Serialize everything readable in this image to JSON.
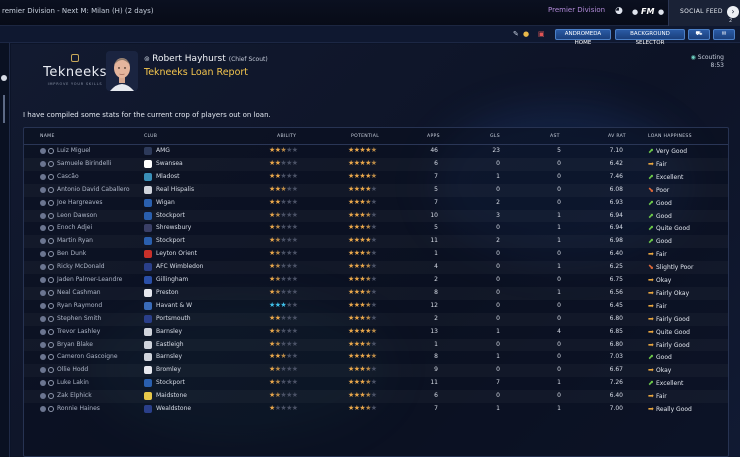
{
  "topbar": {
    "title": "remier Division - Next M: Milan (H) (2 days)",
    "brand": "Premier Division",
    "fm_label": "FM",
    "social_label": "SOCIAL FEED",
    "social_count": "2"
  },
  "subbar": {
    "andromeda_label": "ANDROMEDA HOME",
    "background_label": "BACKGROUND SELECTOR"
  },
  "logo": {
    "word": "Tekneeks",
    "tagline": "IMPROVE YOUR SKILLS"
  },
  "staff": {
    "name": "Robert Hayhurst",
    "role": "(Chief Scout)",
    "report_title": "Tekneeks Loan Report"
  },
  "scouting": {
    "label": "Scouting",
    "time": "8:53"
  },
  "intro": "I have compiled some stats for the current crop of players out on loan.",
  "columns": {
    "name": "NAME",
    "club": "CLUB",
    "ability": "ABILITY",
    "potential": "POTENTIAL",
    "apps": "APPS",
    "gls": "GLS",
    "ast": "AST",
    "avrat": "AV RAT",
    "happiness": "LOAN HAPPINESS"
  },
  "colors": {
    "accent": "#f3c54e",
    "star_on": "#e8a64a",
    "star_off": "#4b5266",
    "star_cyan": "#3fbfe8",
    "up": "#6cc84a",
    "side": "#e8a640",
    "down": "#e06a3a"
  },
  "players": [
    {
      "name": "Luiz Miguel",
      "club": "AMG",
      "crest": "#2d3a5a",
      "ability": 2.5,
      "potential": 4.5,
      "apps": "46",
      "gls": "23",
      "ast": "5",
      "avrat": "7.10",
      "happiness": "Very Good",
      "dir": "up"
    },
    {
      "name": "Samuele Birindelli",
      "club": "Swansea",
      "crest": "#ffffff",
      "ability": 2,
      "potential": 4.5,
      "apps": "6",
      "gls": "0",
      "ast": "0",
      "avrat": "6.42",
      "happiness": "Fair",
      "dir": "side"
    },
    {
      "name": "Cascão",
      "club": "Mladost",
      "crest": "#3a8fb8",
      "ability": 2,
      "potential": 4.5,
      "apps": "7",
      "gls": "1",
      "ast": "0",
      "avrat": "7.46",
      "happiness": "Excellent",
      "dir": "up"
    },
    {
      "name": "Antonio David Caballero",
      "club": "Real Hispalis",
      "crest": "#d0d4dc",
      "ability": 2.5,
      "potential": 4,
      "apps": "5",
      "gls": "0",
      "ast": "0",
      "avrat": "6.08",
      "happiness": "Poor",
      "dir": "down"
    },
    {
      "name": "Joe Hargreaves",
      "club": "Wigan",
      "crest": "#2a5fae",
      "ability": 2,
      "potential": 3.5,
      "apps": "7",
      "gls": "2",
      "ast": "0",
      "avrat": "6.93",
      "happiness": "Good",
      "dir": "up"
    },
    {
      "name": "Leon Dawson",
      "club": "Stockport",
      "crest": "#2a5fae",
      "ability": 1.5,
      "potential": 3.5,
      "apps": "10",
      "gls": "3",
      "ast": "1",
      "avrat": "6.94",
      "happiness": "Good",
      "dir": "up"
    },
    {
      "name": "Enoch Adjei",
      "club": "Shrewsbury",
      "crest": "#3a3f66",
      "ability": 1.5,
      "potential": 3.5,
      "apps": "5",
      "gls": "0",
      "ast": "1",
      "avrat": "6.94",
      "happiness": "Quite Good",
      "dir": "up"
    },
    {
      "name": "Martin Ryan",
      "club": "Stockport",
      "crest": "#2a5fae",
      "ability": 1.5,
      "potential": 4,
      "apps": "11",
      "gls": "2",
      "ast": "1",
      "avrat": "6.98",
      "happiness": "Good",
      "dir": "up"
    },
    {
      "name": "Ben Dunk",
      "club": "Leyton Orient",
      "crest": "#c8302a",
      "ability": 1.5,
      "potential": 3.5,
      "apps": "1",
      "gls": "0",
      "ast": "0",
      "avrat": "6.40",
      "happiness": "Fair",
      "dir": "side"
    },
    {
      "name": "Ricky McDonald",
      "club": "AFC Wimbledon",
      "crest": "#2a3f8a",
      "ability": 1.5,
      "potential": 3.5,
      "apps": "4",
      "gls": "0",
      "ast": "1",
      "avrat": "6.25",
      "happiness": "Slightly Poor",
      "dir": "down"
    },
    {
      "name": "Jaden Palmer-Leandre",
      "club": "Gillingham",
      "crest": "#2a4fa8",
      "ability": 1.5,
      "potential": 3.5,
      "apps": "2",
      "gls": "0",
      "ast": "0",
      "avrat": "6.75",
      "happiness": "Okay",
      "dir": "side"
    },
    {
      "name": "Neal Cashman",
      "club": "Preston",
      "crest": "#e6e8ee",
      "ability": 1.5,
      "potential": 3.5,
      "apps": "8",
      "gls": "0",
      "ast": "1",
      "avrat": "6.56",
      "happiness": "Fairly Okay",
      "dir": "side"
    },
    {
      "name": "Ryan Raymond",
      "club": "Havant & W",
      "crest": "#3a6bb8",
      "ability": 3,
      "potential": 3.5,
      "apps": "12",
      "gls": "0",
      "ast": "0",
      "avrat": "6.45",
      "happiness": "Fair",
      "dir": "side",
      "cyan": true
    },
    {
      "name": "Stephen Smith",
      "club": "Portsmouth",
      "crest": "#2a3f8a",
      "ability": 2,
      "potential": 3.5,
      "apps": "2",
      "gls": "0",
      "ast": "0",
      "avrat": "6.80",
      "happiness": "Fairly Good",
      "dir": "side"
    },
    {
      "name": "Trevor Lashley",
      "club": "Barnsley",
      "crest": "#d0d4dc",
      "ability": 1.5,
      "potential": 4.5,
      "apps": "13",
      "gls": "1",
      "ast": "4",
      "avrat": "6.85",
      "happiness": "Quite Good",
      "dir": "side"
    },
    {
      "name": "Bryan Blake",
      "club": "Eastleigh",
      "crest": "#d0d4dc",
      "ability": 1.5,
      "potential": 3.5,
      "apps": "1",
      "gls": "0",
      "ast": "0",
      "avrat": "6.80",
      "happiness": "Fairly Good",
      "dir": "side"
    },
    {
      "name": "Cameron Gascoigne",
      "club": "Barnsley",
      "crest": "#d0d4dc",
      "ability": 2.5,
      "potential": 4.5,
      "apps": "8",
      "gls": "1",
      "ast": "0",
      "avrat": "7.03",
      "happiness": "Good",
      "dir": "up"
    },
    {
      "name": "Ollie Hodd",
      "club": "Bromley",
      "crest": "#e6e8ee",
      "ability": 1.5,
      "potential": 3.5,
      "apps": "9",
      "gls": "0",
      "ast": "0",
      "avrat": "6.67",
      "happiness": "Okay",
      "dir": "side"
    },
    {
      "name": "Luke Lakin",
      "club": "Stockport",
      "crest": "#2a5fae",
      "ability": 1.5,
      "potential": 3.5,
      "apps": "11",
      "gls": "7",
      "ast": "1",
      "avrat": "7.26",
      "happiness": "Excellent",
      "dir": "up"
    },
    {
      "name": "Zak Elphick",
      "club": "Maidstone",
      "crest": "#e8c84a",
      "ability": 1.5,
      "potential": 3.5,
      "apps": "6",
      "gls": "0",
      "ast": "0",
      "avrat": "6.40",
      "happiness": "Fair",
      "dir": "side"
    },
    {
      "name": "Ronnie Haines",
      "club": "Wealdstone",
      "crest": "#2a3f8a",
      "ability": 1,
      "potential": 3.5,
      "apps": "7",
      "gls": "1",
      "ast": "1",
      "avrat": "7.00",
      "happiness": "Really Good",
      "dir": "side"
    }
  ]
}
